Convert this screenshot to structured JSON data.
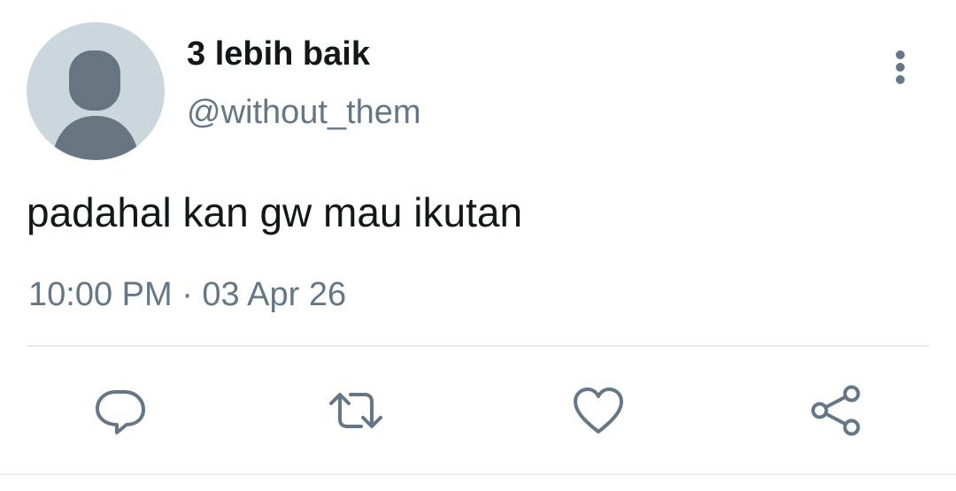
{
  "tweet": {
    "display_name": "3 lebih baik",
    "handle": "@without_them",
    "text": "padahal kan gw mau ikutan",
    "timestamp": "10:00 PM · 03 Apr 26"
  },
  "icons": {
    "avatar": "default-profile-avatar",
    "more": "more-vertical-icon",
    "reply": "reply-icon",
    "retweet": "retweet-icon",
    "like": "heart-icon",
    "share": "share-icon"
  },
  "colors": {
    "text_primary": "#14171a",
    "text_secondary": "#657786",
    "avatar_bg": "#ccd6dd",
    "avatar_figure": "#66757f",
    "divider": "#e6ecf0"
  }
}
